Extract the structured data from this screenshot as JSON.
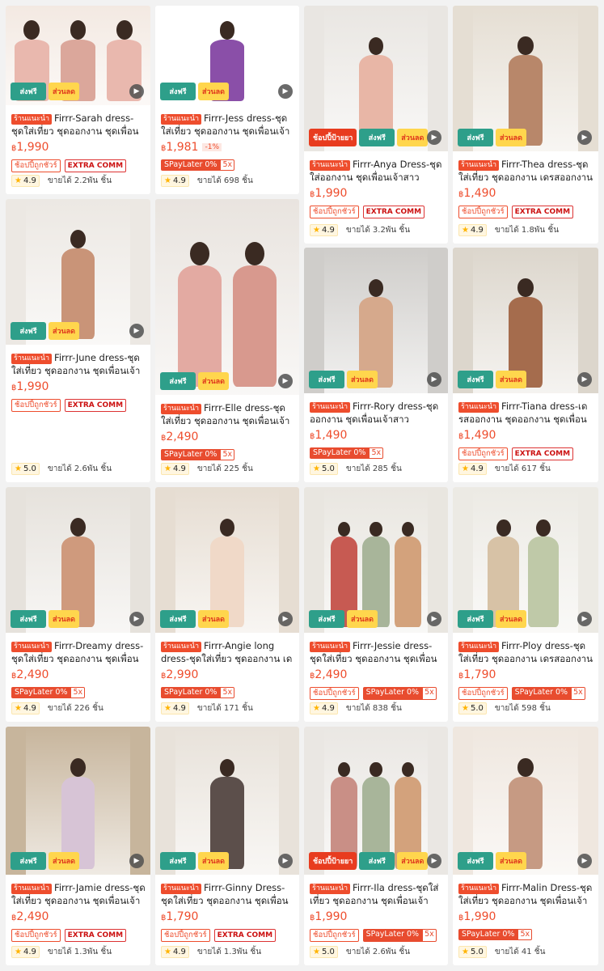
{
  "colors": {
    "accent": "#ee4d2d",
    "free_badge": "#2e9f8a",
    "discount_badge": "#ffd64d",
    "star": "#ffb400"
  },
  "badges": {
    "free_label": "ส่งฟรี",
    "discount_label": "ส่วนลด",
    "choice_label": "ช้อปปี้ป้ายยา"
  },
  "icons": {
    "play": "play-icon",
    "star": "star-icon"
  },
  "labels": {
    "recommended": "ร้านแนะนำ",
    "currency": "฿",
    "coin_tag": "ช้อปปี้ถูกชัวร์",
    "extra_tag": "EXTRA COMM",
    "spay_label": "SPayLater 0%",
    "spay_x": "5x",
    "sold_prefix": "ขายได้"
  },
  "products": [
    {
      "name": "Firrr-Sarah dress-ชุดใส่เที่ยว ชุดออกงาน ชุดเพื่อนเจ้าสาว",
      "price": "1,990",
      "rating": "4.9",
      "sold": "2.2พัน ชิ้น"
    },
    {
      "name": "Firrr-Jess dress-ชุดใส่เที่ยว ชุดออกงาน ชุดเพื่อนเจ้าสาว",
      "price": "1,981",
      "discount": "-1%",
      "rating": "4.9",
      "sold": "698 ชิ้น"
    },
    {
      "name": "Firrr-Anya Dress-ชุดใส่ออกงาน ชุดเพื่อนเจ้าสาว",
      "price": "1,990",
      "rating": "4.9",
      "sold": "3.2พัน ชิ้น"
    },
    {
      "name": "Firrr-Thea dress-ชุดใส่เที่ยว ชุดออกงาน เดรสออกงาน",
      "price": "1,490",
      "rating": "4.9",
      "sold": "1.8พัน ชิ้น"
    },
    {
      "name": "Firrr-June dress-ชุดใส่เที่ยว ชุดออกงาน ชุดเพื่อนเจ้าสาว",
      "price": "1,990",
      "rating": "5.0",
      "sold": "2.6พัน ชิ้น"
    },
    {
      "name": "Firrr-Elle dress-ชุดใส่เที่ยว ชุดออกงาน ชุดเพื่อนเจ้าสาว",
      "price": "2,490",
      "rating": "4.9",
      "sold": "225 ชิ้น"
    },
    {
      "name": "Firrr-Rory dress-ชุดออกงาน ชุดเพื่อนเจ้าสาว",
      "price": "1,490",
      "rating": "5.0",
      "sold": "285 ชิ้น"
    },
    {
      "name": "Firrr-Tiana dress-เดรสออกงาน ชุดออกงาน ชุดเพื่อนเจ้าสาว",
      "price": "1,490",
      "rating": "4.9",
      "sold": "617 ชิ้น"
    },
    {
      "name": "Firrr-Dreamy dress-ชุดใส่เที่ยว ชุดออกงาน ชุดเพื่อนเจ้าสาว",
      "price": "2,490",
      "rating": "4.9",
      "sold": "226 ชิ้น"
    },
    {
      "name": "Firrr-Angie long dress-ชุดใส่เที่ยว ชุดออกงาน เดรสออกงาน",
      "price": "2,990",
      "rating": "4.9",
      "sold": "171 ชิ้น"
    },
    {
      "name": "Firrr-Jessie dress-ชุดใส่เที่ยว ชุดออกงาน ชุดเพื่อนเจ้าสาว",
      "price": "2,490",
      "rating": "4.9",
      "sold": "838 ชิ้น"
    },
    {
      "name": "Firrr-Ploy dress-ชุดใส่เที่ยว ชุดออกงาน เดรสออกงาน",
      "price": "1,790",
      "rating": "5.0",
      "sold": "598 ชิ้น"
    },
    {
      "name": "Firrr-Jamie dress-ชุดใส่เที่ยว ชุดออกงาน ชุดเพื่อนเจ้าสาว",
      "price": "2,490",
      "rating": "4.9",
      "sold": "1.3พัน ชิ้น"
    },
    {
      "name": "Firrr-Ginny Dress-ชุดใส่เที่ยว ชุดออกงาน ชุดเพื่อนเจ้าสาว",
      "price": "1,790",
      "rating": "4.9",
      "sold": "1.3พัน ชิ้น"
    },
    {
      "name": "Firrr-Ila dress-ชุดใส่เที่ยว ชุดออกงาน ชุดเพื่อนเจ้าสาว",
      "price": "1,990",
      "rating": "5.0",
      "sold": "2.6พัน ชิ้น"
    },
    {
      "name": "Firrr-Malin Dress-ชุดใส่เที่ยว ชุดออกงาน ชุดเพื่อนเจ้าสาว",
      "price": "1,990",
      "rating": "5.0",
      "sold": "41 ชิ้น"
    }
  ]
}
